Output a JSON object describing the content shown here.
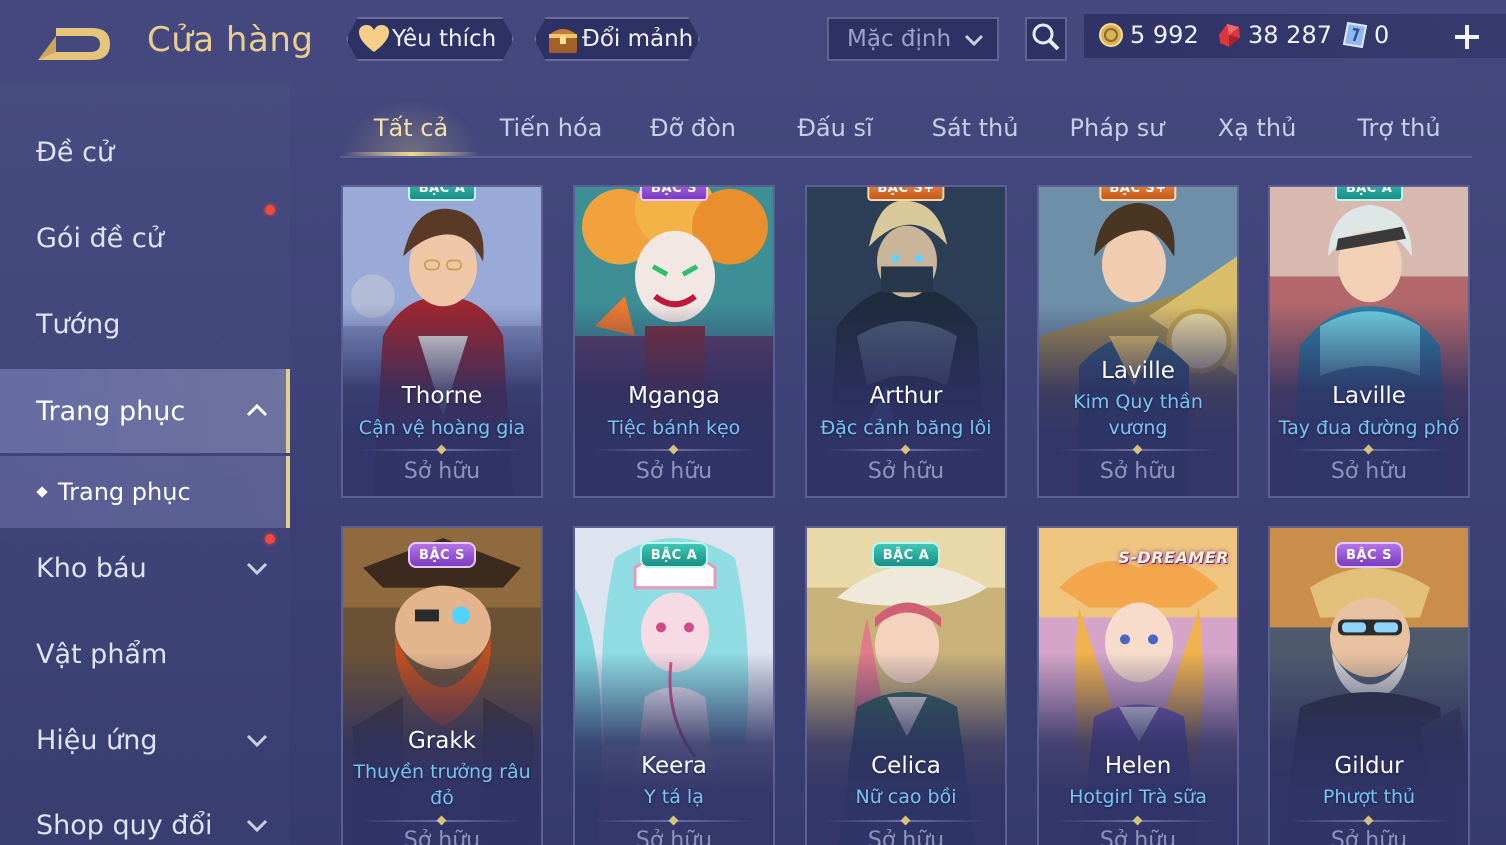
{
  "header": {
    "title": "Cửa hàng",
    "favorite_label": "Yêu thích",
    "fragment_label": "Đổi mảnh",
    "sort_value": "Mặc định",
    "gold": "5 992",
    "ruby": "38 287",
    "voucher": "0"
  },
  "sidebar": {
    "items": [
      {
        "label": "Đề cử"
      },
      {
        "label": "Gói đề cử"
      },
      {
        "label": "Tướng"
      },
      {
        "label": "Trang phục"
      },
      {
        "label": "Kho báu"
      },
      {
        "label": "Vật phẩm"
      },
      {
        "label": "Hiệu ứng"
      },
      {
        "label": "Shop quy đổi"
      }
    ],
    "sub_item": "Trang phục"
  },
  "tabs": [
    "Tất cả",
    "Tiến hóa",
    "Đỡ đòn",
    "Đấu sĩ",
    "Sát thủ",
    "Pháp sư",
    "Xạ thủ",
    "Trợ thủ"
  ],
  "cards": [
    {
      "hero": "Thorne",
      "skin": "Cận vệ hoàng gia",
      "status": "Sở hữu",
      "badge": "BẬC A"
    },
    {
      "hero": "Mganga",
      "skin": "Tiệc bánh kẹo",
      "status": "Sở hữu",
      "badge": "BẬC S"
    },
    {
      "hero": "Arthur",
      "skin": "Đặc cảnh băng lôi",
      "status": "Sở hữu",
      "badge": "BẬC S+"
    },
    {
      "hero": "Laville",
      "skin": "Kim Quy thần vương",
      "status": "Sở hữu",
      "badge": "BẬC S+"
    },
    {
      "hero": "Laville",
      "skin": "Tay đua đường phố",
      "status": "Sở hữu",
      "badge": "BẬC A"
    },
    {
      "hero": "Grakk",
      "skin": "Thuyền trưởng râu đỏ",
      "status": "Sở hữu",
      "badge": "BẬC S"
    },
    {
      "hero": "Keera",
      "skin": "Y tá lạ",
      "status": "Sở hữu",
      "badge": "BẬC A"
    },
    {
      "hero": "Celica",
      "skin": "Nữ cao bồi",
      "status": "Sở hữu",
      "badge": "BẬC A"
    },
    {
      "hero": "Helen",
      "skin": "Hotgirl Trà sữa",
      "status": "Sở hữu",
      "badge": "S-DREAMER"
    },
    {
      "hero": "Gildur",
      "skin": "Phượt thủ",
      "status": "Sở hữu",
      "badge": "BẬC S"
    }
  ],
  "colors": {
    "accent_gold": "#e9cf8f",
    "skin_name_blue": "#79c4f2",
    "badge_s": "#9a55d6",
    "badge_a": "#2aa89d",
    "badge_splus": "#e07a35",
    "notification_red": "#f2473d"
  }
}
